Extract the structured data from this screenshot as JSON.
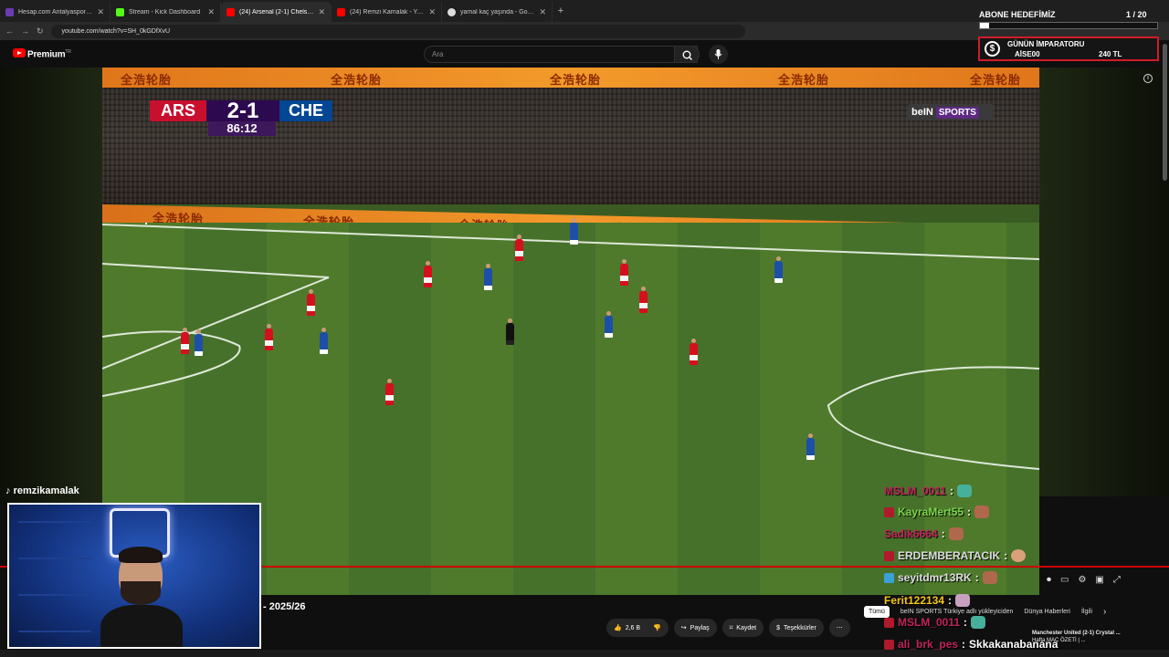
{
  "browser": {
    "tabs": [
      {
        "title": "Hesap.com Antalyaspor - Fenerbahçe",
        "favicon_color": "#6a3bb5"
      },
      {
        "title": "Stream - Kick Dashboard",
        "favicon_color": "#53fc18"
      },
      {
        "title": "(24) Arsenal (2-1) Chelsea | ...",
        "favicon_color": "#ff0000"
      },
      {
        "title": "(24) Remzi Kamalak - YouTube",
        "favicon_color": "#ff0000"
      },
      {
        "title": "yamal kaç yaşında - Google'da Ara",
        "favicon_color": "#dddddd"
      }
    ],
    "new_tab": "+",
    "url": "youtube.com/watch?v=SH_0kGDfXvU"
  },
  "youtube": {
    "brand": "Premium",
    "brand_sup": "TR",
    "search_placeholder": "Ara",
    "title_fragment": "- 2025/26",
    "actions": {
      "like_count": "2,6 B",
      "share": "Paylaş",
      "save": "Kaydet",
      "thanks": "Teşekkürler",
      "more": "⋯"
    },
    "chips": [
      "Tümü",
      "beIN SPORTS Türkiye adlı yükleyiciden",
      "Dünya Haberleri",
      "İlgili"
    ],
    "related": {
      "title": "Manchester United (2-1) Crystal ...",
      "subtitle": "Hafta MAÇ ÖZETİ | ..."
    }
  },
  "match": {
    "home": "ARS",
    "score": "2-1",
    "away": "CHE",
    "clock": "86:12",
    "broadcaster": "beIN",
    "broadcaster_suffix": "SPORTS",
    "board_text": "全浩轮胎"
  },
  "stream": {
    "streamer": "remzikamalak",
    "goal_label": "ABONE HEDEFİMİZ",
    "goal_count": "1 / 20",
    "goal_progress": 0.05,
    "emperor_title": "GÜNÜN İMPARATORU",
    "emperor_user": "AİSE00",
    "emperor_amount": "240 TL",
    "emperor_icon": "dollar-coin-icon",
    "chat": [
      {
        "user": "MSLM_0011",
        "color": "#c0245a",
        "text": ""
      },
      {
        "user": "KayraMert55",
        "color": "#7cd64a",
        "text": ""
      },
      {
        "user": "Sadik6664",
        "color": "#c0245a",
        "text": ""
      },
      {
        "user": "ERDEMBERATACIK",
        "color": "#dddddd",
        "text": ""
      },
      {
        "user": "seyitdmr13RK",
        "color": "#dddddd",
        "text": ""
      },
      {
        "user": "Ferit122134",
        "color": "#f5c518",
        "text": ""
      },
      {
        "user": "MSLM_0011",
        "color": "#c0245a",
        "text": ""
      },
      {
        "user": "ali_brk_pes",
        "color": "#c0245a",
        "text": "Skkakanabanana"
      }
    ]
  }
}
